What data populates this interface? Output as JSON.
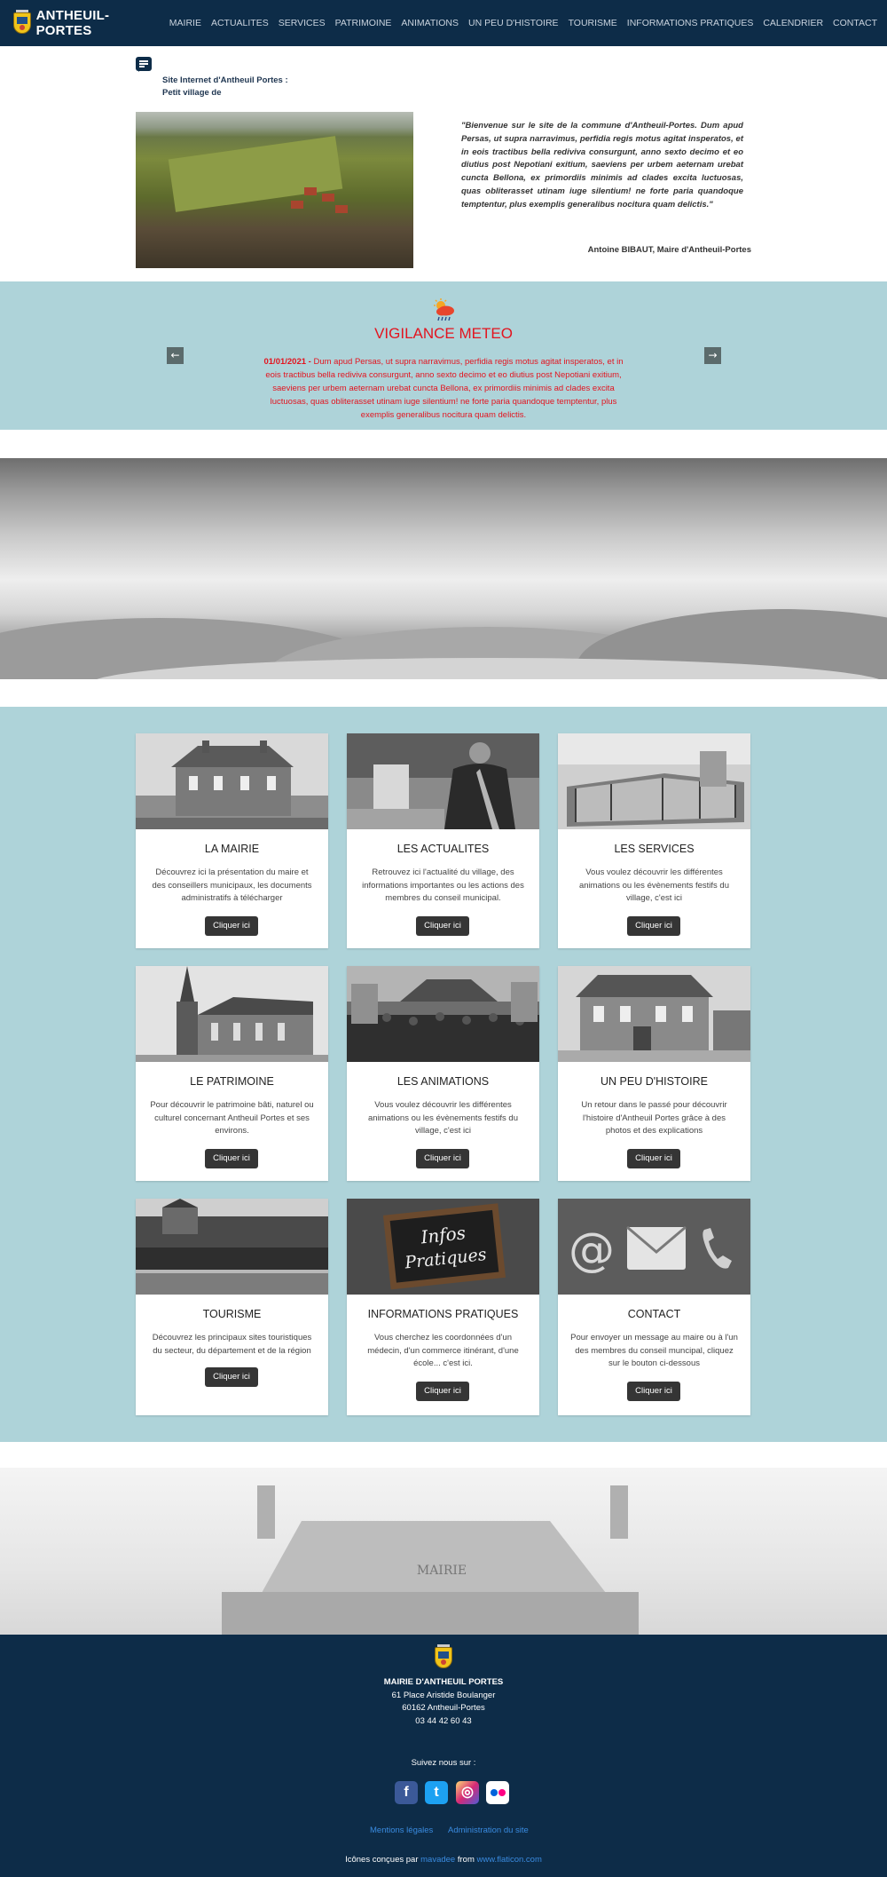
{
  "nav": {
    "brand": "ANTHEUIL-PORTES",
    "items": [
      "MAIRIE",
      "ACTUALITES",
      "SERVICES",
      "PATRIMOINE",
      "ANIMATIONS",
      "UN PEU D'HISTOIRE",
      "TOURISME",
      "INFORMATIONS PRATIQUES",
      "CALENDRIER",
      "CONTACT"
    ]
  },
  "welcome": {
    "title_line1": "Site Internet d'Antheuil Portes :",
    "title_line2": "Petit village de",
    "quote": "\"Bienvenue sur le site de la commune d'Antheuil-Portes. Dum apud Persas, ut supra narravimus, perfidia regis motus agitat insperatos, et in eois tractibus bella rediviva consurgunt, anno sexto decimo et eo diutius post Nepotiani exitium, saeviens per urbem aeternam urebat cuncta Bellona, ex primordiis minimis ad clades excita luctuosas, quas obliterasset utinam iuge silentium! ne forte paria quandoque temptentur, plus exemplis generalibus nocitura quam delictis.\"",
    "author": "Antoine BIBAUT, Maire d'Antheuil-Portes"
  },
  "meteo": {
    "title": "VIGILANCE METEO",
    "date": "01/01/2021 -",
    "text": " Dum apud Persas, ut supra narravimus, perfidia regis motus agitat insperatos, et in eois tractibus bella rediviva consurgunt, anno sexto decimo et eo diutius post Nepotiani exitium, saeviens per urbem aeternam urebat cuncta Bellona, ex primordiis minimis ad clades excita luctuosas, quas obliterasset utinam iuge silentium! ne forte paria quandoque temptentur, plus exemplis generalibus nocitura quam delictis.",
    "prev": "←",
    "next": "→",
    "alert_color": "#e3141f"
  },
  "cards": [
    {
      "title": "LA MAIRIE",
      "desc": "Découvrez ici la présentation du maire et des conseillers municipaux, les documents administratifs à télécharger",
      "button": "Cliquer ici"
    },
    {
      "title": "LES ACTUALITES",
      "desc": "Retrouvez ici l'actualité du village, des informations importantes ou les actions des membres du conseil municipal.",
      "button": "Cliquer ici"
    },
    {
      "title": "LES SERVICES",
      "desc": "Vous voulez découvrir les différentes animations ou les évènements festifs du village, c'est ici",
      "button": "Cliquer ici"
    },
    {
      "title": "LE PATRIMOINE",
      "desc": "Pour découvrir le patrimoine bâti, naturel ou culturel concernant Antheuil Portes et ses environs.",
      "button": "Cliquer ici"
    },
    {
      "title": "LES ANIMATIONS",
      "desc": "Vous voulez découvrir les différentes animations ou les évènements festifs du village, c'est ici",
      "button": "Cliquer ici"
    },
    {
      "title": "UN PEU D'HISTOIRE",
      "desc": "Un retour dans le passé pour découvrir l'histoire d'Antheuil Portes grâce à des photos et des explications",
      "button": "Cliquer ici"
    },
    {
      "title": "TOURISME",
      "desc": "Découvrez les principaux sites touristiques du secteur, du département et de la région",
      "button": "Cliquer ici"
    },
    {
      "title": "INFORMATIONS PRATIQUES",
      "desc": "Vous cherchez les coordonnées d'un médecin, d'un commerce itinérant, d'une école... c'est ici.",
      "button": "Cliquer ici"
    },
    {
      "title": "CONTACT",
      "desc": "Pour envoyer un message au maire ou à l'un des membres du conseil muncipal, cliquez sur le bouton ci-dessous",
      "button": "Cliquer ici"
    }
  ],
  "infos_image_text": {
    "line1": "Infos",
    "line2": "Pratiques"
  },
  "house_sign": "MAIRIE",
  "footer": {
    "name": "MAIRIE D'ANTHEUIL PORTES",
    "address1": "61 Place Aristide Boulanger",
    "address2": "60162 Antheuil-Portes",
    "phone": "03 44 42 60 43",
    "follow": "Suivez nous sur :",
    "legal": "Mentions légales",
    "admin": "Administration du site",
    "credit_prefix": "Icônes conçues par",
    "credit_author": "mavadee",
    "credit_mid": "from",
    "credit_site": "www.flaticon.com"
  },
  "social": [
    {
      "icon": "facebook-icon",
      "glyph": "f",
      "color": "#3b5998"
    },
    {
      "icon": "twitter-icon",
      "glyph": "t",
      "color": "#1da1f2"
    },
    {
      "icon": "instagram-icon",
      "glyph": "◎",
      "color": "#c13584"
    },
    {
      "icon": "flickr-icon",
      "glyph": "●●",
      "color": "#ffffff"
    }
  ]
}
